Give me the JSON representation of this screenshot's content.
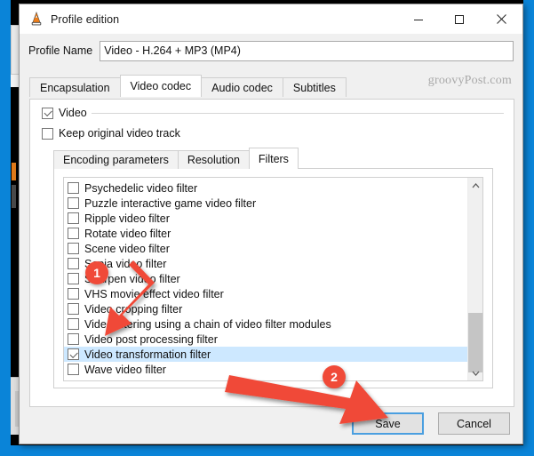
{
  "window": {
    "title": "Profile edition",
    "app_icon": "vlc-cone-icon",
    "minimize_label": "Minimize",
    "maximize_label": "Maximize",
    "close_label": "Close"
  },
  "watermark": "groovyPost.com",
  "profile": {
    "label": "Profile Name",
    "value": "Video - H.264 + MP3 (MP4)",
    "placeholder": "Profile Name"
  },
  "outer_tabs": [
    {
      "label": "Encapsulation",
      "active": false
    },
    {
      "label": "Video codec",
      "active": true
    },
    {
      "label": "Audio codec",
      "active": false
    },
    {
      "label": "Subtitles",
      "active": false
    }
  ],
  "video_group": {
    "label": "Video",
    "checked": true
  },
  "keep_original": {
    "label": "Keep original video track",
    "checked": false
  },
  "inner_tabs": [
    {
      "label": "Encoding parameters",
      "active": false
    },
    {
      "label": "Resolution",
      "active": false
    },
    {
      "label": "Filters",
      "active": true
    }
  ],
  "filters": [
    {
      "label": "Psychedelic video filter",
      "checked": false,
      "selected": false
    },
    {
      "label": "Puzzle interactive game video filter",
      "checked": false,
      "selected": false
    },
    {
      "label": "Ripple video filter",
      "checked": false,
      "selected": false
    },
    {
      "label": "Rotate video filter",
      "checked": false,
      "selected": false
    },
    {
      "label": "Scene video filter",
      "checked": false,
      "selected": false
    },
    {
      "label": "Sepia video filter",
      "checked": false,
      "selected": false
    },
    {
      "label": "Sharpen video filter",
      "checked": false,
      "selected": false
    },
    {
      "label": "VHS movie effect video filter",
      "checked": false,
      "selected": false
    },
    {
      "label": "Video cropping filter",
      "checked": false,
      "selected": false
    },
    {
      "label": "Video filtering using a chain of video filter modules",
      "checked": false,
      "selected": false
    },
    {
      "label": "Video post processing filter",
      "checked": false,
      "selected": false
    },
    {
      "label": "Video transformation filter",
      "checked": true,
      "selected": true
    },
    {
      "label": "Wave video filter",
      "checked": false,
      "selected": false
    }
  ],
  "scrollbar": {
    "up_arrow": "chevron-up-icon",
    "down_arrow": "chevron-down-icon"
  },
  "buttons": {
    "save": "Save",
    "cancel": "Cancel"
  },
  "annotations": {
    "badge_1": "1",
    "badge_2": "2",
    "accent_color": "#f04a38"
  }
}
